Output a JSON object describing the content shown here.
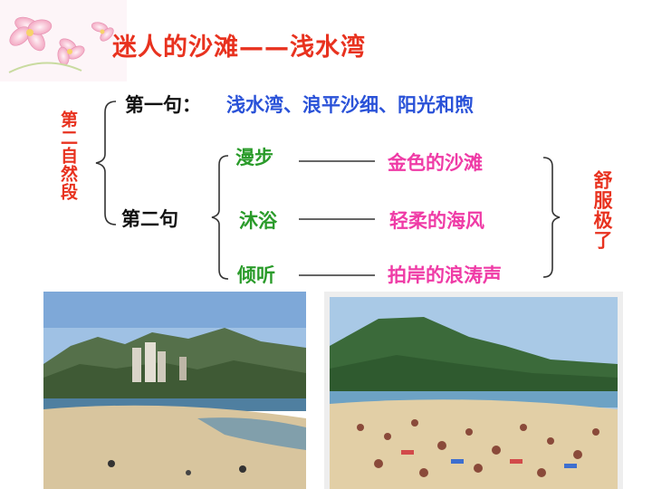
{
  "title": "迷人的沙滩——浅水湾",
  "paragraph_label": "第二自然段",
  "sentence1": {
    "label": "第一句：",
    "content": "浅水湾、浪平沙细、阳光和煦"
  },
  "sentence2": {
    "label": "第二句",
    "activities": [
      {
        "verb": "漫步",
        "object": "金色的沙滩"
      },
      {
        "verb": "沐浴",
        "object": "轻柔的海风"
      },
      {
        "verb": "倾听",
        "object": "拍岸的浪涛声"
      }
    ]
  },
  "conclusion": "舒服极了",
  "colors": {
    "title": "#e8321f",
    "label": "#111111",
    "sentence1_content": "#2a52d8",
    "verbs": "#2a9b2a",
    "objects": "#ef3ba6"
  },
  "images": [
    {
      "name": "beach-town-photo",
      "description_icon": "photo-icon"
    },
    {
      "name": "crowded-beach-photo",
      "description_icon": "photo-icon"
    }
  ]
}
